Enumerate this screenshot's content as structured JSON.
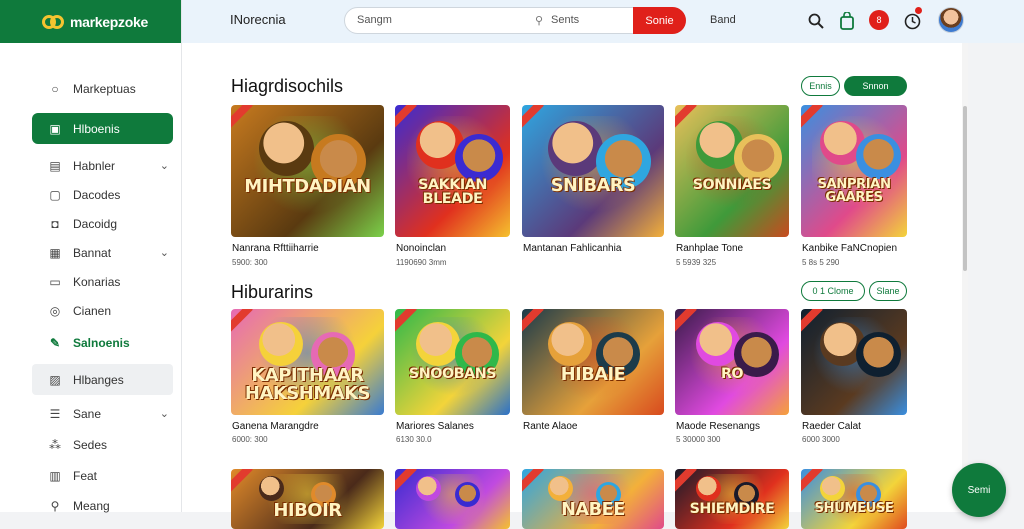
{
  "app": {
    "logo_text": "markepzoke"
  },
  "sidebar": {
    "items": [
      {
        "label": "Markeptuas",
        "icon": "pin-icon",
        "glyph": "○",
        "state": "normal",
        "chevron": false
      },
      {
        "label": "Hlboenis",
        "icon": "home-icon",
        "glyph": "▣",
        "state": "active",
        "chevron": false
      },
      {
        "label": "Habnler",
        "icon": "card-icon",
        "glyph": "▤",
        "state": "normal",
        "chevron": true
      },
      {
        "label": "Dacodes",
        "icon": "document-icon",
        "glyph": "▢",
        "state": "normal",
        "chevron": false
      },
      {
        "label": "Dacoidg",
        "icon": "lock-icon",
        "glyph": "◘",
        "state": "normal",
        "chevron": false
      },
      {
        "label": "Bannat",
        "icon": "clipboard-icon",
        "glyph": "▦",
        "state": "normal",
        "chevron": true
      },
      {
        "label": "Konarias",
        "icon": "folder-icon",
        "glyph": "▭",
        "state": "normal",
        "chevron": false
      },
      {
        "label": "Cianen",
        "icon": "globe-icon",
        "glyph": "◎",
        "state": "normal",
        "chevron": false
      },
      {
        "label": "Salnoenis",
        "icon": "leaf-icon",
        "glyph": "✎",
        "state": "green",
        "chevron": false
      },
      {
        "label": "Hlbanges",
        "icon": "image-icon",
        "glyph": "▨",
        "state": "hover",
        "chevron": false
      },
      {
        "label": "Sane",
        "icon": "list-icon",
        "glyph": "☰",
        "state": "normal",
        "chevron": true
      },
      {
        "label": "Sedes",
        "icon": "grid-icon",
        "glyph": "⁂",
        "state": "normal",
        "chevron": false
      },
      {
        "label": "Feat",
        "icon": "building-icon",
        "glyph": "▥",
        "state": "normal",
        "chevron": false
      },
      {
        "label": "Meang",
        "icon": "search-icon",
        "glyph": "⚲",
        "state": "normal",
        "chevron": false
      }
    ]
  },
  "topbar": {
    "breadcrumb": "INorecnia",
    "search": {
      "placeholder": "Sangm",
      "secondary": "Sents",
      "button": "Sonie"
    },
    "link": "Band",
    "badge": "8",
    "icons": [
      "search-icon",
      "bag-icon",
      "notification-badge",
      "clock-icon",
      "avatar"
    ]
  },
  "sections": [
    {
      "title": "Hiagrdisochils",
      "pills": [
        "Ennis",
        "Snnon"
      ],
      "cards": [
        {
          "name": "Nanrana Rfttiiharrie",
          "meta": "5900: 300",
          "thumb_title": "MIHTDADIAN",
          "palette": [
            "#c77a1f",
            "#5a3a10",
            "#7bd14a"
          ]
        },
        {
          "name": "Nonoinclan",
          "meta": "1190690 3mm",
          "thumb_title": "SAKKIAN BLEADE",
          "palette": [
            "#3b2bd1",
            "#e0301e",
            "#f5c12e"
          ]
        },
        {
          "name": "Mantanan Fahlicanhia",
          "meta": "",
          "thumb_title": "SNIBARS",
          "palette": [
            "#2fa6e0",
            "#5b3a7a",
            "#f3b03a"
          ]
        },
        {
          "name": "Ranhplae Tone",
          "meta": "5 5939 325",
          "thumb_title": "SONNIAES",
          "palette": [
            "#e8c05a",
            "#3f9a3a",
            "#c94a1e"
          ]
        },
        {
          "name": "Kanbike FaNCnopien",
          "meta": "5 8s 5 290",
          "thumb_title": "SANPRIAN GAARES",
          "palette": [
            "#3a8fe0",
            "#e04a8a",
            "#f3d43a"
          ]
        }
      ]
    },
    {
      "title": "Hiburarins",
      "pills": [
        "0 1 Clome",
        "Slane"
      ],
      "cards": [
        {
          "name": "Ganena Marangdre",
          "meta": "6000: 300",
          "thumb_title": "KAPITHAAR HAKSHMAKS",
          "palette": [
            "#e66ab4",
            "#f5d13a",
            "#3a7bd0"
          ]
        },
        {
          "name": "Mariores Salanes",
          "meta": "6130 30.0",
          "thumb_title": "SNOOBANS",
          "palette": [
            "#2fb84a",
            "#f3d43a",
            "#2a70c9"
          ]
        },
        {
          "name": "Rante Alaoe",
          "meta": "",
          "thumb_title": "HIBAIE",
          "palette": [
            "#1c3b4a",
            "#e6a13a",
            "#d84a1e"
          ]
        },
        {
          "name": "Maode Resenangs",
          "meta": "5 30000 300",
          "thumb_title": "RO",
          "palette": [
            "#3a1b4a",
            "#e04ae0",
            "#f5a13a"
          ]
        },
        {
          "name": "Raeder Calat",
          "meta": "6000 3000",
          "thumb_title": "",
          "palette": [
            "#0f2030",
            "#5a3a20",
            "#3a8fe0"
          ]
        }
      ]
    },
    {
      "title": "",
      "pills": [],
      "cards": [
        {
          "name": "",
          "meta": "",
          "thumb_title": "HIBOIR",
          "palette": [
            "#e08a2a",
            "#4a2a1a",
            "#f3d43a"
          ]
        },
        {
          "name": "",
          "meta": "",
          "thumb_title": "",
          "palette": [
            "#3a2bd1",
            "#c04ae0",
            "#f5c12e"
          ]
        },
        {
          "name": "",
          "meta": "",
          "thumb_title": "NABEE",
          "palette": [
            "#2fa6e0",
            "#f3b03a",
            "#e04a8a"
          ]
        },
        {
          "name": "",
          "meta": "",
          "thumb_title": "SHIEMDIRE",
          "palette": [
            "#1a1a2a",
            "#e0301e",
            "#f3d43a"
          ]
        },
        {
          "name": "",
          "meta": "",
          "thumb_title": "SHUMEUSE",
          "palette": [
            "#3a8fe0",
            "#f3d43a",
            "#e04a1e"
          ]
        }
      ]
    }
  ],
  "fab": {
    "label": "Semi"
  },
  "colors": {
    "brand": "#0f7a3c",
    "accent": "#e0201a",
    "topbar": "#eaf3fb"
  }
}
